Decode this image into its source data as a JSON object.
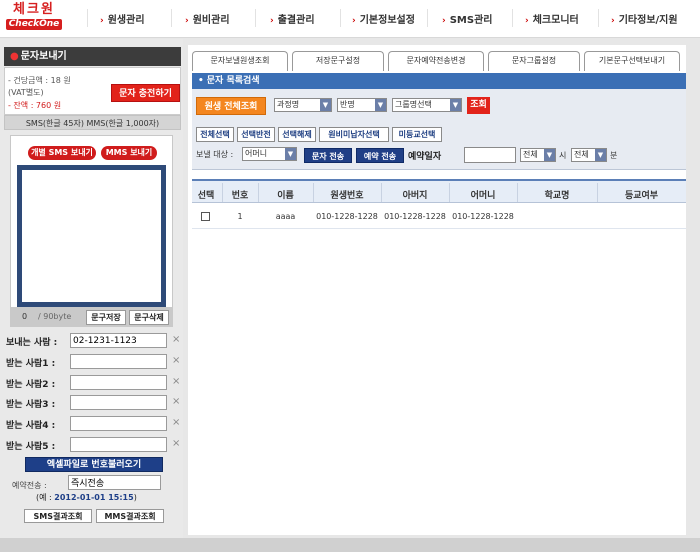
{
  "nav": {
    "logo_korean": "체크원",
    "logo_brand": "CheckOne",
    "items": [
      {
        "label": "원생관리"
      },
      {
        "label": "원비관리"
      },
      {
        "label": "출결관리"
      },
      {
        "label": "기본정보설정"
      },
      {
        "label": "SMS관리"
      },
      {
        "label": "체크모니터"
      },
      {
        "label": "기타정보/지원"
      }
    ]
  },
  "left": {
    "title": "문자보내기",
    "balance_line1": "- 건당금액 : 18 원",
    "balance_line2": "(VAT별도)",
    "balance_line3": "- 잔액 : 760 원",
    "charge_button": "문자 충전하기",
    "sms_type": "SMS(한글 45자) MMS(한글 1,000자)",
    "sms_button": "개별 SMS 보내기",
    "mms_button": "MMS 보내기",
    "message_value": "",
    "byte_count": "0",
    "byte_max": "/ 90byte",
    "save_phrase": "문구저장",
    "delete_phrase": "문구삭제",
    "sender_label": "보내는 사람 :",
    "sender_value": "02-1231-1123",
    "recipients": [
      {
        "label": "받는 사람1 :",
        "value": ""
      },
      {
        "label": "받는 사람2 :",
        "value": ""
      },
      {
        "label": "받는 사람3 :",
        "value": ""
      },
      {
        "label": "받는 사람4 :",
        "value": ""
      },
      {
        "label": "받는 사람5 :",
        "value": ""
      }
    ],
    "excel_button": "엑셀파일로 번호불러오기",
    "reserve_label": "예약전송 :",
    "reserve_value": "즉시전송",
    "reserve_example_prefix": "(예 : ",
    "reserve_example_value": "2012-01-01 15:15",
    "reserve_example_suffix": ")",
    "sms_result_button": "SMS결과조회",
    "mms_result_button": "MMS결과조회"
  },
  "tabs": [
    {
      "label": "문자보낼원생조회"
    },
    {
      "label": "저장문구설정"
    },
    {
      "label": "문자예약전송변경"
    },
    {
      "label": "문자그룹설정"
    },
    {
      "label": "기본문구선택보내기"
    }
  ],
  "search": {
    "section_title": "문자 목록검색",
    "search_all_button": "원생 전체조회",
    "course_select": "과정명",
    "class_select": "반명",
    "group_select": "그룹명선택",
    "query_button": "조회",
    "select_all": "전체선택",
    "select_invert": "선택반전",
    "select_clear": "선택해제",
    "select_unpaid": "원비미납자선택",
    "select_absent": "미등교선택",
    "target_label": "보낼 대상 :",
    "target_select": "어머니",
    "send_button": "문자 전송",
    "reserve_send_button": "예약 전송",
    "reserve_date_label": "예약일자",
    "reserve_date_value": "",
    "hour_select": "전체",
    "hour_unit": "시",
    "minute_select": "전체",
    "minute_unit": "분"
  },
  "table": {
    "columns": [
      "선택",
      "번호",
      "이름",
      "원생번호",
      "아버지",
      "어머니",
      "학교명",
      "등교여부"
    ],
    "rows": [
      {
        "no": "1",
        "name": "aaaa",
        "student_phone": "010-1228-1228",
        "father": "010-1228-1228",
        "mother": "010-1228-1228",
        "school": "",
        "attend": ""
      }
    ]
  },
  "colors": {
    "brand_red": "#d61f1f",
    "nav_blue": "#203f86",
    "header_blue": "#3b6fb5",
    "orange": "#f4861f"
  }
}
